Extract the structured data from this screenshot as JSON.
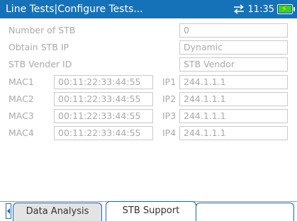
{
  "header": {
    "title": "Line Tests|Configure Tests...",
    "time": "11:35",
    "icons": [
      "sync-arrows-icon",
      "battery-charging-icon"
    ]
  },
  "form": {
    "number_of_stb": {
      "label": "Number of STB",
      "value": "0"
    },
    "obtain_stb_ip": {
      "label": "Obtain STB IP",
      "value": "Dynamic"
    },
    "stb_vendor_id": {
      "label": "STB Vender ID",
      "value": "STB Vendor"
    },
    "rows": [
      {
        "mac_label": "MAC1",
        "mac": "00:11:22:33:44:55",
        "ip_label": "IP1",
        "ip": "244.1.1.1"
      },
      {
        "mac_label": "MAC2",
        "mac": "00:11:22:33:44:55",
        "ip_label": "IP2",
        "ip": "244.1.1.1"
      },
      {
        "mac_label": "MAC3",
        "mac": "00:11:22:33:44:55",
        "ip_label": "IP3",
        "ip": "244.1.1.1"
      },
      {
        "mac_label": "MAC4",
        "mac": "00:11:22:33:44:55",
        "ip_label": "IP4",
        "ip": "244.1.1.1"
      }
    ]
  },
  "tabs": {
    "items": [
      {
        "label": "Data Analysis",
        "active": false
      },
      {
        "label": "STB Support",
        "active": true
      },
      {
        "label": "",
        "active": false
      }
    ]
  },
  "colors": {
    "titlebar": "#1672b8",
    "tab_border": "#1d67ad",
    "disabled_text": "#a9a9a9"
  }
}
